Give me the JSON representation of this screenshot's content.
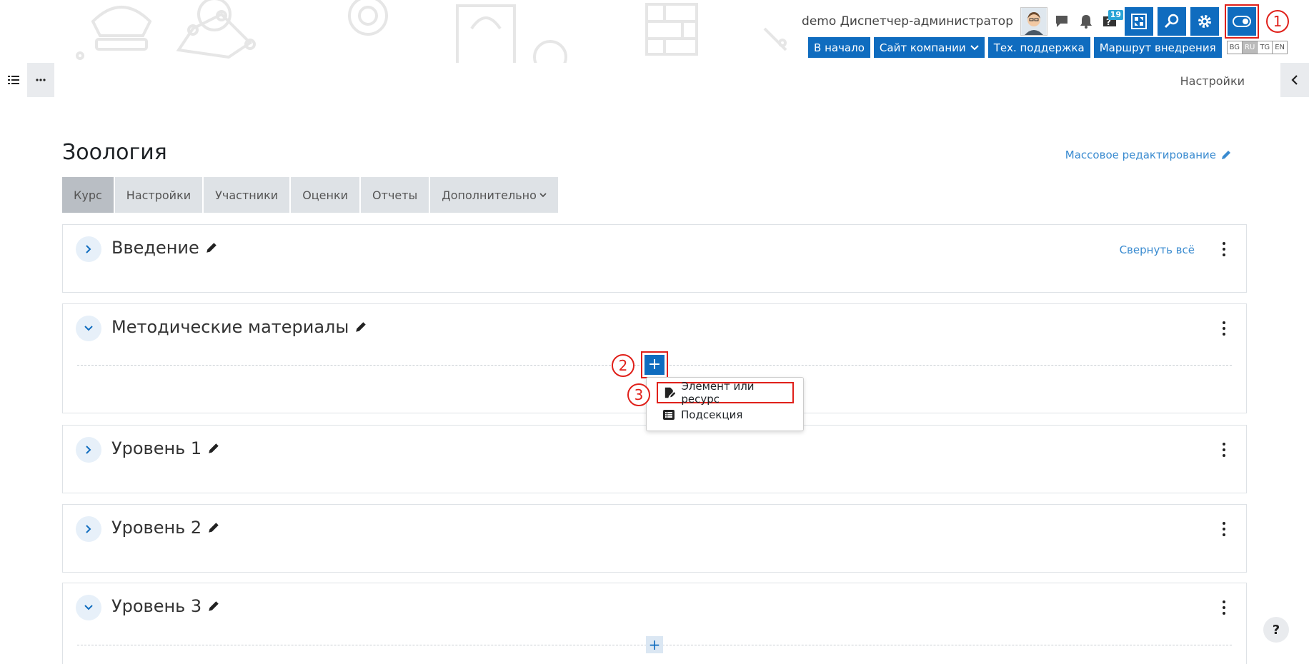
{
  "header": {
    "user_name": "demo Диспетчер-администратор",
    "messages_badge": "19",
    "annotation_1": "1",
    "nav_buttons": [
      "В начало",
      "Сайт компании",
      "Тех. поддержка",
      "Маршрут внедрения"
    ],
    "languages": [
      "BG",
      "RU",
      "TG",
      "EN"
    ],
    "active_language": "RU"
  },
  "drawer": {
    "settings_label": "Настройки"
  },
  "page": {
    "title": "Зоология",
    "bulk_edit_label": "Массовое редактирование"
  },
  "tabs": [
    {
      "label": "Курс",
      "active": true
    },
    {
      "label": "Настройки"
    },
    {
      "label": "Участники"
    },
    {
      "label": "Оценки"
    },
    {
      "label": "Отчеты"
    },
    {
      "label": "Дополнительно"
    }
  ],
  "sections": [
    {
      "title": "Введение",
      "expanded": false,
      "collapse_all_label": "Свернуть всё"
    },
    {
      "title": "Методические материалы",
      "expanded": true
    },
    {
      "title": "Уровень 1",
      "expanded": false
    },
    {
      "title": "Уровень 2",
      "expanded": false
    },
    {
      "title": "Уровень 3",
      "expanded": true
    }
  ],
  "annotations": {
    "two": "2",
    "three": "3"
  },
  "add_menu": {
    "items": [
      "Элемент или ресурс",
      "Подсекция"
    ]
  },
  "help_label": "?",
  "icons": {
    "section_collapsed": "chevron-right-icon",
    "section_expanded": "chevron-down-icon",
    "edit": "pencil-icon"
  },
  "colors": {
    "primary": "#0f6cbf",
    "link": "#3a8bd0",
    "annotation": "#e0201a",
    "tab_bg": "#dee2e6",
    "tab_active_bg": "#b9bec4"
  }
}
